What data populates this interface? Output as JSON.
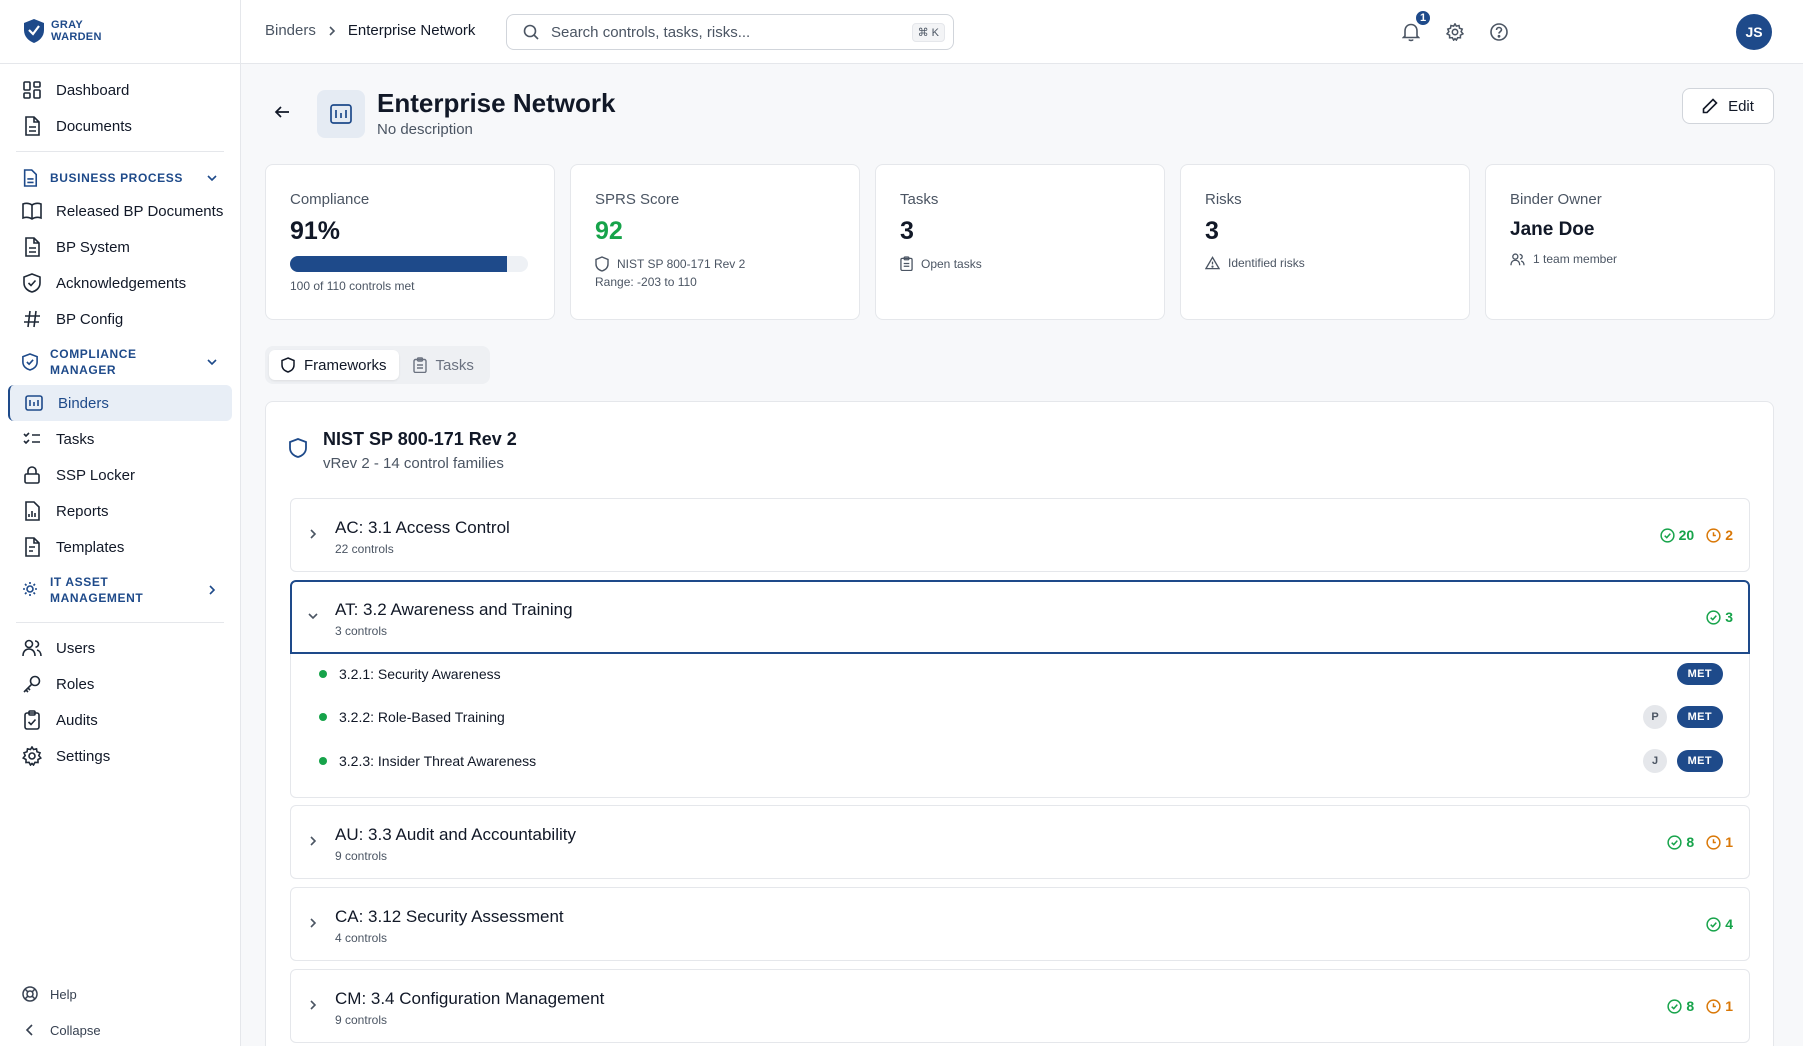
{
  "brand": {
    "line1": "GRAY",
    "line2": "WARDEN"
  },
  "sidebar": {
    "top_items": [
      {
        "label": "Dashboard",
        "icon": "dashboard-icon"
      },
      {
        "label": "Documents",
        "icon": "document-icon"
      }
    ],
    "business_process": {
      "label": "BUSINESS PROCESS",
      "items": [
        {
          "label": "Released BP Documents",
          "icon": "book-icon"
        },
        {
          "label": "BP System",
          "icon": "document-icon"
        },
        {
          "label": "Acknowledgements",
          "icon": "shield-check-icon"
        },
        {
          "label": "BP Config",
          "icon": "hash-icon"
        }
      ]
    },
    "compliance_manager": {
      "label_line1": "COMPLIANCE",
      "label_line2": "MANAGER",
      "items": [
        {
          "label": "Binders",
          "icon": "binder-icon",
          "active": true
        },
        {
          "label": "Tasks",
          "icon": "list-checks-icon"
        },
        {
          "label": "SSP Locker",
          "icon": "lock-icon"
        },
        {
          "label": "Reports",
          "icon": "report-icon"
        },
        {
          "label": "Templates",
          "icon": "template-icon"
        }
      ]
    },
    "it_asset": {
      "label_line1": "IT ASSET",
      "label_line2": "MANAGEMENT"
    },
    "admin_items": [
      {
        "label": "Users",
        "icon": "users-icon"
      },
      {
        "label": "Roles",
        "icon": "key-icon"
      },
      {
        "label": "Audits",
        "icon": "clipboard-check-icon"
      },
      {
        "label": "Settings",
        "icon": "gear-icon"
      }
    ],
    "footer": {
      "help": "Help",
      "collapse": "Collapse"
    }
  },
  "topbar": {
    "breadcrumb": {
      "parent": "Binders",
      "current": "Enterprise Network"
    },
    "search": {
      "placeholder": "Search controls, tasks, risks...",
      "shortcut": "⌘ K"
    },
    "notification_count": "1",
    "avatar_initials": "JS"
  },
  "header": {
    "title": "Enterprise Network",
    "description": "No description",
    "edit_label": "Edit"
  },
  "cards": {
    "compliance": {
      "label": "Compliance",
      "value": "91%",
      "progress": 0.91,
      "sub": "100 of 110 controls met"
    },
    "sprs": {
      "label": "SPRS Score",
      "value": "92",
      "framework": "NIST SP 800-171 Rev 2",
      "range": "Range: -203 to 110"
    },
    "tasks": {
      "label": "Tasks",
      "value": "3",
      "sub": "Open tasks"
    },
    "risks": {
      "label": "Risks",
      "value": "3",
      "sub": "Identified risks"
    },
    "owner": {
      "label": "Binder Owner",
      "value": "Jane Doe",
      "sub": "1 team member"
    }
  },
  "tabs": {
    "frameworks": "Frameworks",
    "tasks": "Tasks"
  },
  "framework": {
    "title": "NIST SP 800-171 Rev 2",
    "subtitle": "vRev 2 - 14 control families",
    "families": [
      {
        "title": "AC: 3.1 Access Control",
        "count": "22 controls",
        "met": "20",
        "warn": "2"
      },
      {
        "title": "AT: 3.2 Awareness and Training",
        "count": "3 controls",
        "met": "3",
        "warn": null,
        "expanded": true
      },
      {
        "title": "AU: 3.3 Audit and Accountability",
        "count": "9 controls",
        "met": "8",
        "warn": "1"
      },
      {
        "title": "CA: 3.12 Security Assessment",
        "count": "4 controls",
        "met": "4",
        "warn": null
      },
      {
        "title": "CM: 3.4 Configuration Management",
        "count": "9 controls",
        "met": "8",
        "warn": "1"
      }
    ],
    "controls": [
      {
        "label": "3.2.1: Security Awareness",
        "assignee": null,
        "status": "MET"
      },
      {
        "label": "3.2.2: Role-Based Training",
        "assignee": "P",
        "status": "MET"
      },
      {
        "label": "3.2.3: Insider Threat Awareness",
        "assignee": "J",
        "status": "MET"
      }
    ]
  },
  "colors": {
    "brand": "#1e4a8a",
    "met": "#16a34a",
    "warn": "#d97706"
  }
}
